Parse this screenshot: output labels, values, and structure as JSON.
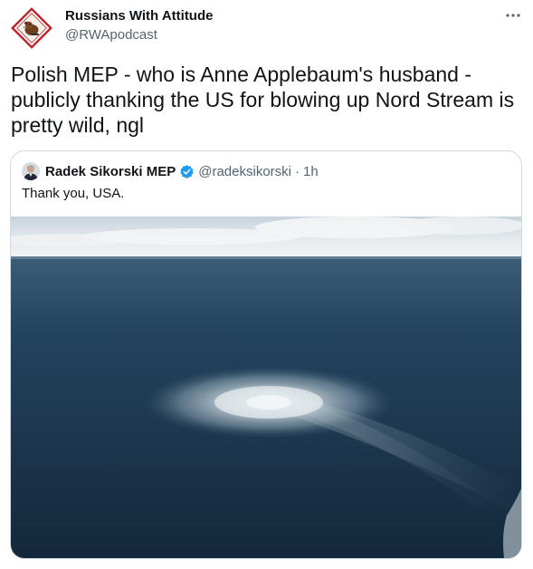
{
  "tweet": {
    "author": {
      "name": "Russians With Attitude",
      "handle": "@RWApodcast"
    },
    "text": "Polish MEP - who is Anne Applebaum's husband -\npublicly thanking the US for blowing up Nord Stream is\npretty wild, ngl",
    "more_icon": "more-horizontal-icon"
  },
  "quote": {
    "author": {
      "name": "Radek Sikorski MEP",
      "handle": "@radeksikorski",
      "verified_icon": "verified-badge-icon",
      "verified_color": "#1d9bf0"
    },
    "separator": "·",
    "time": "1h",
    "text": "Thank you, USA."
  },
  "colors": {
    "text_primary": "#0f1419",
    "text_secondary": "#536471",
    "border": "#cfd9de",
    "sea": "#1e3a52",
    "sky": "#dfe6ea"
  }
}
